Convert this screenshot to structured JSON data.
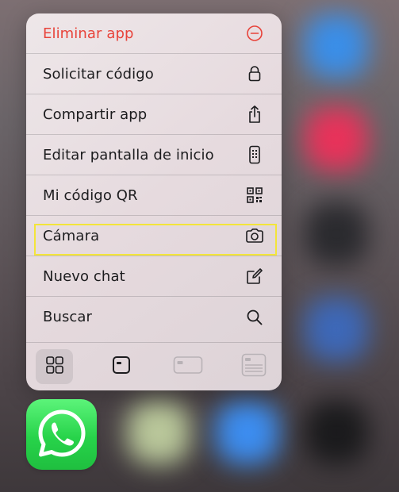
{
  "menu": {
    "items": [
      {
        "label": "Eliminar app",
        "icon": "minus-circle-icon",
        "destructive": true
      },
      {
        "label": "Solicitar código",
        "icon": "lock-icon"
      },
      {
        "label": "Compartir app",
        "icon": "share-icon"
      },
      {
        "label": "Editar pantalla de inicio",
        "icon": "phone-edit-icon"
      },
      {
        "label": "Mi código QR",
        "icon": "qr-code-icon"
      },
      {
        "label": "Cámara",
        "icon": "camera-icon"
      },
      {
        "label": "Nuevo chat",
        "icon": "compose-icon"
      },
      {
        "label": "Buscar",
        "icon": "search-icon"
      }
    ]
  },
  "widget_sizes": {
    "options": [
      {
        "icon": "grid-small-icon",
        "selected": true
      },
      {
        "icon": "widget-small-icon",
        "selected": false
      },
      {
        "icon": "widget-medium-icon",
        "selected": false
      },
      {
        "icon": "widget-large-icon",
        "selected": false
      }
    ]
  },
  "app": {
    "icon": "whatsapp-icon"
  },
  "colors": {
    "destructive": "#e8433a",
    "highlight": "#f3e53a",
    "whatsapp_green": "#27d34a"
  }
}
